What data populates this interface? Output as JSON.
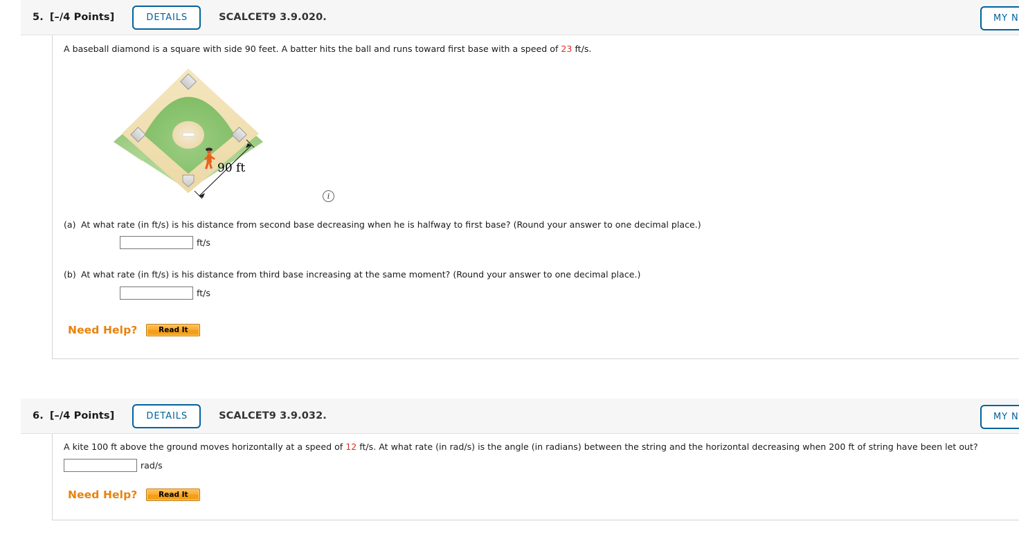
{
  "questions": [
    {
      "number": "5.",
      "points": "[–/4 Points]",
      "details_label": "DETAILS",
      "code": "SCALCET9 3.9.020.",
      "notes_label": "MY NOTES",
      "prompt_pre": "A baseball diamond is a square with side 90 feet. A batter hits the ball and runs toward first base with a speed of ",
      "prompt_highlight": "23",
      "prompt_post": " ft/s.",
      "figure": {
        "name": "baseball-diamond-diagram",
        "dimension_label": "90 ft",
        "info_icon": "info-icon",
        "colors": {
          "outfield_grass": "#a8d18d",
          "infield_dirt": "#f0dfb0",
          "infield_grass": "#8dc671",
          "base": "#d8d8d8",
          "runner": "#e8601c"
        }
      },
      "parts": [
        {
          "label": "(a)",
          "text": "At what rate (in ft/s) is his distance from second base decreasing when he is halfway to first base? (Round your answer to one decimal place.)",
          "answer_value": "",
          "answer_placeholder": "",
          "unit": "ft/s"
        },
        {
          "label": "(b)",
          "text": "At what rate (in ft/s) is his distance from third base increasing at the same moment? (Round your answer to one decimal place.)",
          "answer_value": "",
          "answer_placeholder": "",
          "unit": "ft/s"
        }
      ],
      "need_help_label": "Need Help?",
      "read_it_label": "Read It"
    },
    {
      "number": "6.",
      "points": "[–/4 Points]",
      "details_label": "DETAILS",
      "code": "SCALCET9 3.9.032.",
      "notes_label": "MY NOTES",
      "prompt_pre": "A kite 100 ft above the ground moves horizontally at a speed of ",
      "prompt_highlight": "12",
      "prompt_post": " ft/s. At what rate (in rad/s) is the angle (in radians) between the string and the horizontal decreasing when 200 ft of string have been let out?",
      "answer_value": "",
      "answer_placeholder": "",
      "unit": "rad/s",
      "need_help_label": "Need Help?",
      "read_it_label": "Read It"
    }
  ]
}
